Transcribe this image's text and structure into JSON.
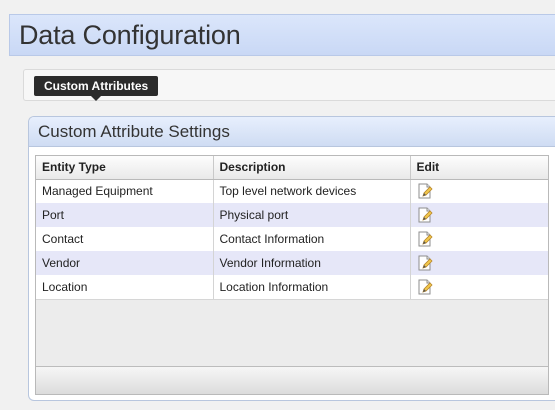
{
  "page": {
    "title": "Data Configuration"
  },
  "tabs": [
    {
      "label": "Custom Attributes",
      "active": true
    }
  ],
  "panel": {
    "title": "Custom Attribute Settings"
  },
  "table": {
    "columns": [
      "Entity Type",
      "Description",
      "Edit"
    ],
    "rows": [
      {
        "entity_type": "Managed Equipment",
        "description": "Top level network devices",
        "edit_icon": "edit-document-icon"
      },
      {
        "entity_type": "Port",
        "description": "Physical port",
        "edit_icon": "edit-document-icon"
      },
      {
        "entity_type": "Contact",
        "description": "Contact Information",
        "edit_icon": "edit-document-icon"
      },
      {
        "entity_type": "Vendor",
        "description": "Vendor Information",
        "edit_icon": "edit-document-icon"
      },
      {
        "entity_type": "Location",
        "description": "Location Information",
        "edit_icon": "edit-document-icon"
      }
    ]
  },
  "colors": {
    "title_bar": "#c9d8f5",
    "tab_background": "#2b2b2b",
    "alt_row": "#e6e7f8",
    "panel_border": "#b8c6de"
  }
}
